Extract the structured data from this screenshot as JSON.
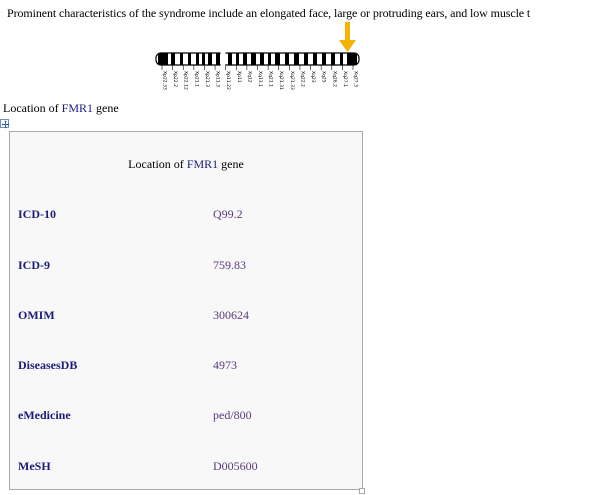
{
  "document": {
    "intro_text": "Prominent characteristics of the syndrome include an elongated face, large or protruding ears, and low muscle t"
  },
  "ideogram": {
    "band_labels": [
      "Xp22.33",
      "Xp22.2",
      "Xp22.12",
      "Xp21.1",
      "Xp21.3",
      "Xp11.3",
      "Xp11.22",
      "Xp11",
      "Xq12",
      "Xq13.1",
      "Xq21.1",
      "Xq21.31",
      "Xq21.33",
      "Xq22.2",
      "Xq23",
      "Xq25",
      "Xq26.2",
      "Xq27.1",
      "Xq27.3"
    ],
    "marker_color": "#f2b400",
    "marker_icon": "down-arrow"
  },
  "figure": {
    "caption_prefix": "Location of ",
    "caption_gene": "FMR1",
    "caption_suffix": " gene"
  },
  "infobox": {
    "caption_prefix": "Location of ",
    "caption_gene": "FMR1",
    "caption_suffix": " gene",
    "rows": [
      {
        "key": "ICD-10",
        "value": "Q99.2"
      },
      {
        "key": "ICD-9",
        "value": "759.83"
      },
      {
        "key": "OMIM",
        "value": "300624"
      },
      {
        "key": "DiseasesDB",
        "value": "4973"
      },
      {
        "key": "eMedicine",
        "value": "ped/800"
      },
      {
        "key": "MeSH",
        "value": "D005600"
      }
    ]
  },
  "colors": {
    "link": "#1b1b7a",
    "value": "#5b3a7a",
    "box_bg": "#f8f8f8",
    "box_border": "#a9a9a9"
  }
}
